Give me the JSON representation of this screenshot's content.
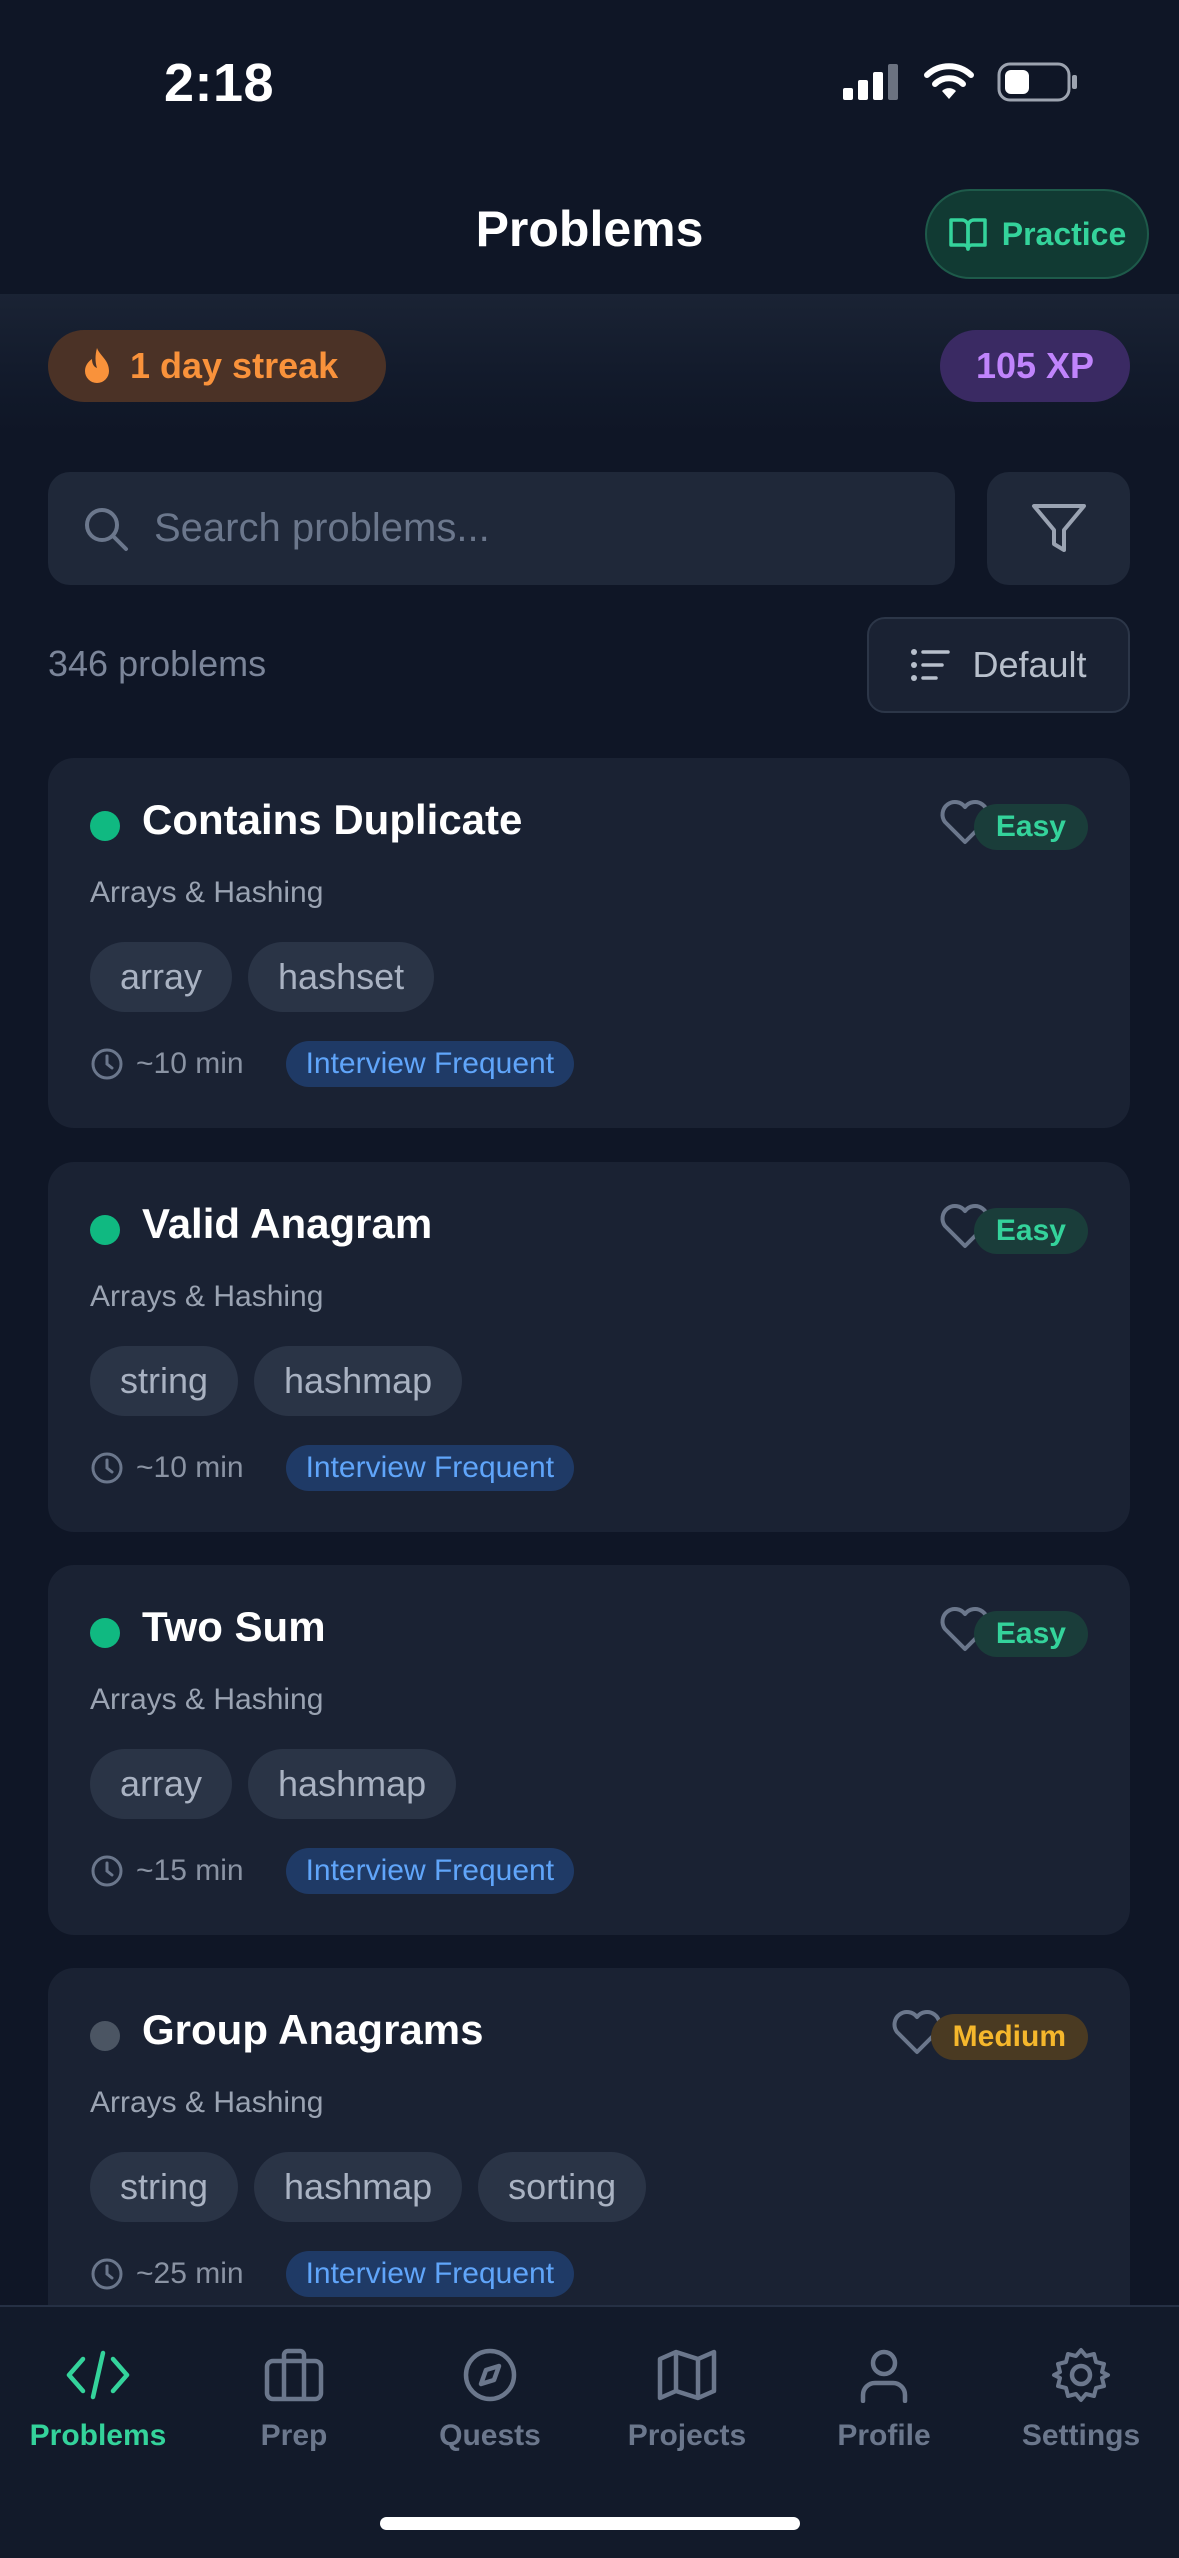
{
  "status_bar": {
    "time": "2:18"
  },
  "header": {
    "title": "Problems",
    "practice_label": "Practice"
  },
  "stats": {
    "streak_label": "1 day streak",
    "xp_label": "105 XP"
  },
  "search": {
    "placeholder": "Search problems...",
    "value": ""
  },
  "list": {
    "count_label": "346 problems",
    "sort_label": "Default"
  },
  "problems": [
    {
      "title": "Contains Duplicate",
      "category": "Arrays & Hashing",
      "tags": [
        "array",
        "hashset"
      ],
      "time": "~10 min",
      "badge": "Interview Frequent",
      "difficulty": "Easy",
      "status_color": "#10b981"
    },
    {
      "title": "Valid Anagram",
      "category": "Arrays & Hashing",
      "tags": [
        "string",
        "hashmap"
      ],
      "time": "~10 min",
      "badge": "Interview Frequent",
      "difficulty": "Easy",
      "status_color": "#10b981"
    },
    {
      "title": "Two Sum",
      "category": "Arrays & Hashing",
      "tags": [
        "array",
        "hashmap"
      ],
      "time": "~15 min",
      "badge": "Interview Frequent",
      "difficulty": "Easy",
      "status_color": "#10b981"
    },
    {
      "title": "Group Anagrams",
      "category": "Arrays & Hashing",
      "tags": [
        "string",
        "hashmap",
        "sorting"
      ],
      "time": "~25 min",
      "badge": "Interview Frequent",
      "difficulty": "Medium",
      "status_color": "#4b5563"
    }
  ],
  "tabs": [
    {
      "label": "Problems",
      "icon": "code-icon",
      "active": true
    },
    {
      "label": "Prep",
      "icon": "briefcase-icon",
      "active": false
    },
    {
      "label": "Quests",
      "icon": "compass-icon",
      "active": false
    },
    {
      "label": "Projects",
      "icon": "map-icon",
      "active": false
    },
    {
      "label": "Profile",
      "icon": "user-icon",
      "active": false
    },
    {
      "label": "Settings",
      "icon": "gear-icon",
      "active": false
    }
  ],
  "colors": {
    "accent": "#34d39b",
    "background": "#0f1626",
    "card": "#1a2233",
    "streak": "#f9923b",
    "xp": "#c084fc",
    "link_badge": "#60a5fa"
  }
}
